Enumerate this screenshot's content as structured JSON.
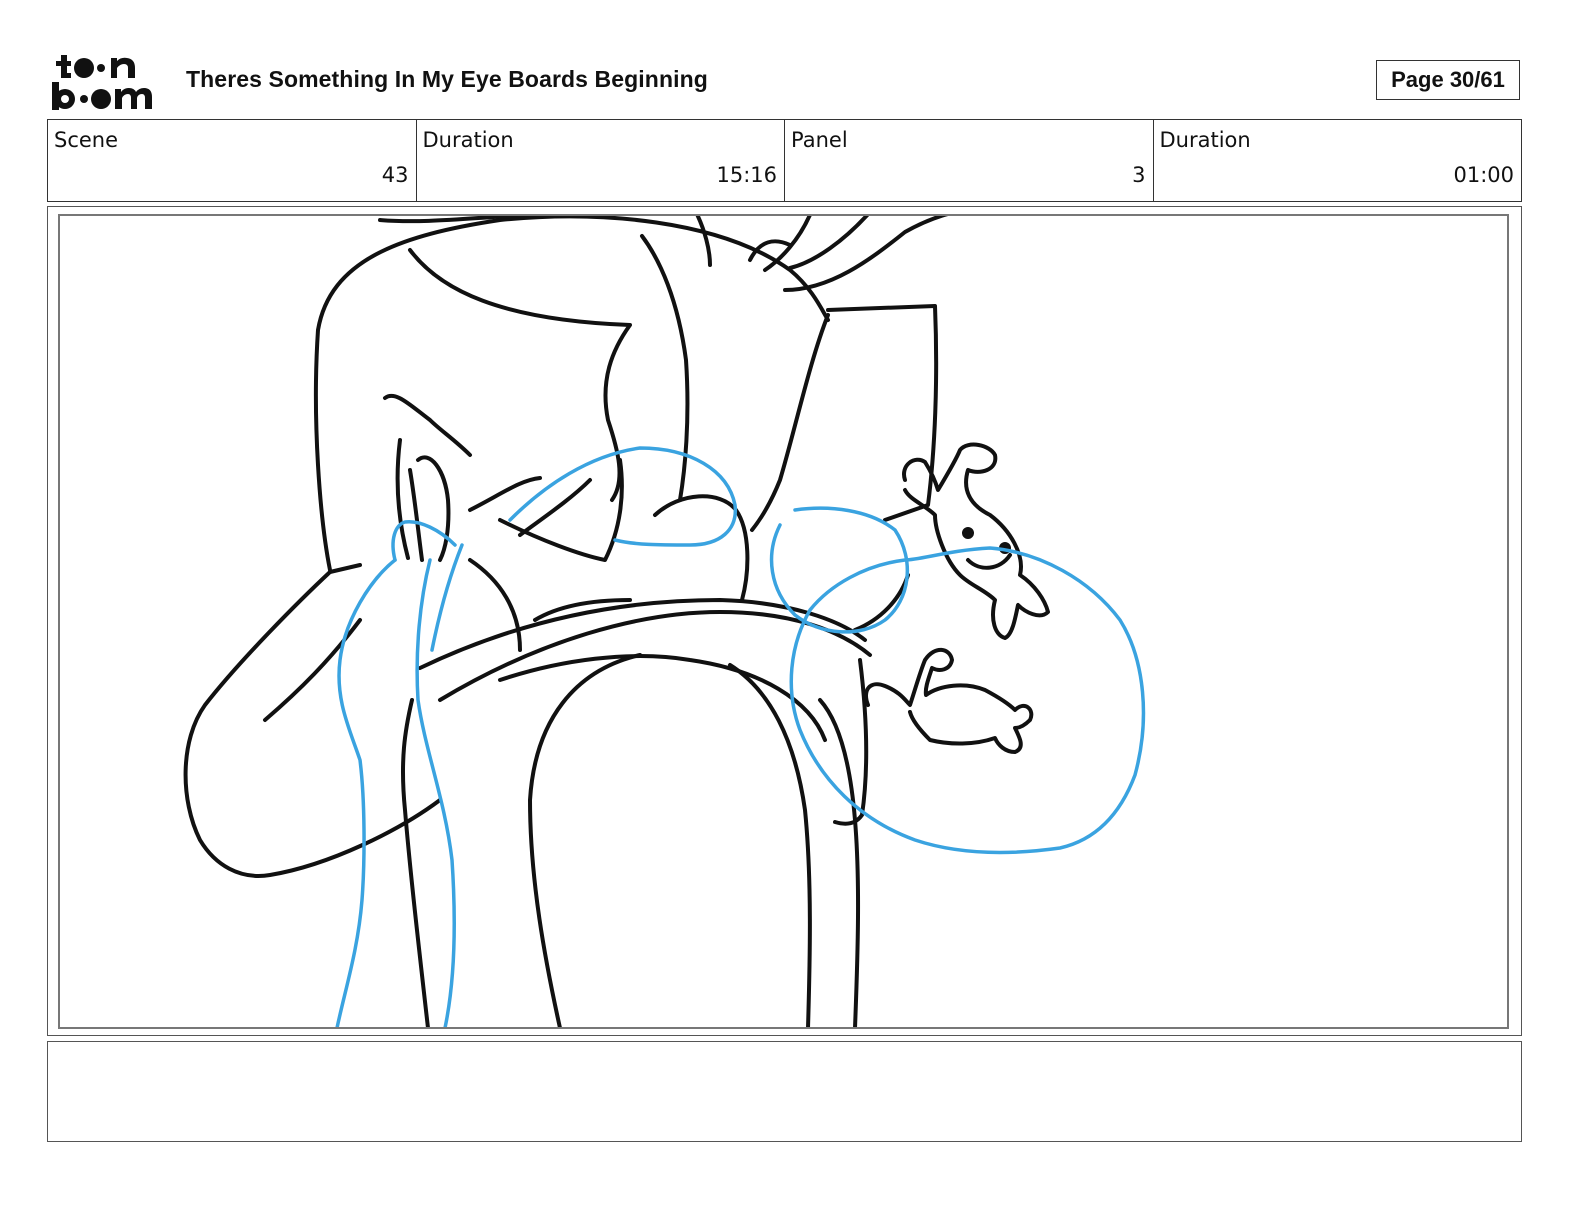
{
  "header": {
    "logo_alt": "toon boom",
    "title": "Theres Something In My Eye Boards Beginning",
    "page": "Page 30/61"
  },
  "info": {
    "scene_label": "Scene",
    "scene_value": "43",
    "scene_duration_label": "Duration",
    "scene_duration_value": "15:16",
    "panel_label": "Panel",
    "panel_value": "3",
    "panel_duration_label": "Duration",
    "panel_duration_value": "01:00"
  },
  "panel": {
    "line_color": "#111111",
    "rough_color": "#3aa3e0"
  },
  "notes": {
    "text": ""
  }
}
